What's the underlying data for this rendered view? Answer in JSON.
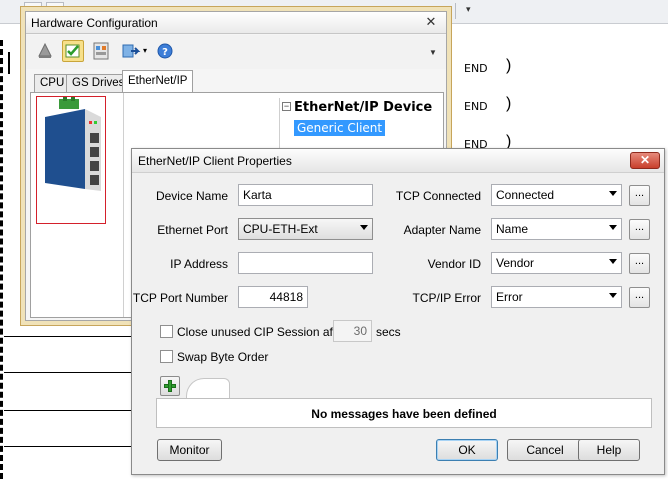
{
  "background": {
    "rung_end_labels": [
      "END",
      "END",
      "END"
    ],
    "rung_parens": [
      ")",
      ")",
      ")"
    ]
  },
  "hw_config": {
    "title": "Hardware Configuration",
    "close_symbol": "✕",
    "toolbar_icons": [
      "bell-icon",
      "checkmark-icon",
      "module-list-icon",
      "import-dropdown-icon",
      "help-icon"
    ],
    "tabs": [
      "CPU",
      "GS Drives",
      "EtherNet/IP"
    ],
    "active_tab": "EtherNet/IP",
    "tree": {
      "expander": "−",
      "root_label": "EtherNet/IP Device",
      "selected_child": "Generic Client"
    }
  },
  "dialog": {
    "title": "EtherNet/IP Client Properties",
    "close_symbol": "✕",
    "device_name": {
      "label": "Device Name",
      "value": "Karta"
    },
    "ethernet_port": {
      "label": "Ethernet Port",
      "value": "CPU-ETH-Ext"
    },
    "ip_address": {
      "label": "IP Address",
      "value": ""
    },
    "tcp_port": {
      "label": "TCP Port Number",
      "value": "44818"
    },
    "tcp_connected": {
      "label": "TCP Connected",
      "value": "Connected",
      "more": "..."
    },
    "adapter_name": {
      "label": "Adapter Name",
      "value": "Name",
      "more": "..."
    },
    "vendor_id": {
      "label": "Vendor ID",
      "value": "Vendor",
      "more": "..."
    },
    "tcpip_error": {
      "label": "TCP/IP Error",
      "value": "Error",
      "more": "..."
    },
    "close_unused": {
      "label": "Close unused CIP Session after",
      "checked": false,
      "value": "30",
      "unit": "secs"
    },
    "swap_byte_order": {
      "label": "Swap Byte Order",
      "checked": false
    },
    "messages_empty_text": "No messages have been defined",
    "buttons": {
      "monitor": "Monitor",
      "ok": "OK",
      "cancel": "Cancel",
      "help": "Help"
    }
  },
  "colors": {
    "selection": "#3399ff",
    "device_border": "#d4202b",
    "add_green": "#2f9e2f",
    "dialog_close_red": "#c8402c"
  }
}
